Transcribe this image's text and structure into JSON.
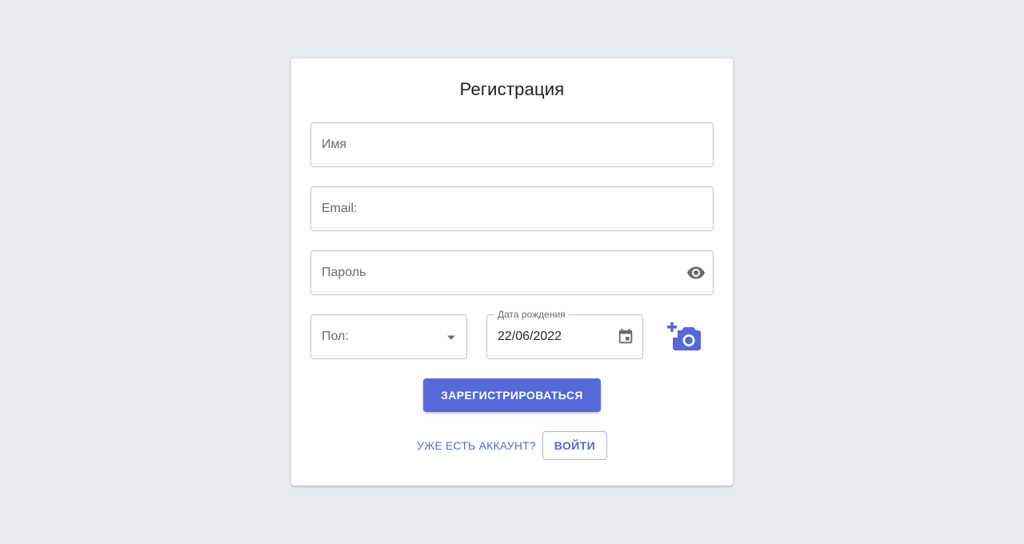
{
  "form": {
    "title": "Регистрация",
    "name_placeholder": "Имя",
    "email_placeholder": "Email:",
    "password_placeholder": "Пароль",
    "gender_placeholder": "Пол:",
    "birthdate_label": "Дата рождения",
    "birthdate_value": "22/06/2022",
    "register_label": "ЗАРЕГИСТРИРОВАТЬСЯ",
    "has_account_text": "УЖЕ ЕСТЬ АККАУНТ?",
    "login_label": "ВОЙТИ"
  },
  "icons": {
    "password_toggle": "eye-icon",
    "dropdown": "chevron-down-icon",
    "calendar": "calendar-icon",
    "photo_upload": "add-photo-camera-icon"
  },
  "colors": {
    "accent": "#5569d8",
    "background": "#e6e9ee",
    "card": "#ffffff"
  }
}
